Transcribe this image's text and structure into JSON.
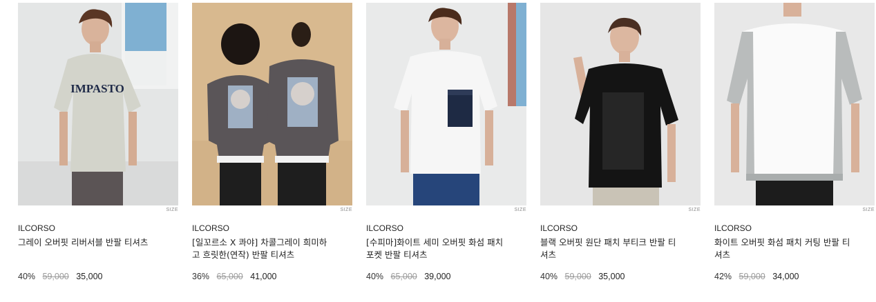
{
  "products": [
    {
      "image_alt": "gray oversized reversible t-shirt model",
      "size_tag": "SIZE",
      "brand": "ILCORSO",
      "name": "그레이 오버핏 리버서블 반팔 티셔츠",
      "discount": "40%",
      "original_price": "59,000",
      "sale_price": "35,000",
      "shirt_print": "IMPASTO",
      "colors": {
        "bg": "#e4e6e6",
        "shirt": "#d3d4cb",
        "pants": "#5b5455"
      }
    },
    {
      "image_alt": "two models back view charcoal gray t-shirts",
      "size_tag": "SIZE",
      "brand": "ILCORSO",
      "name": "[일꼬르소 X 콰야] 차콜그레이 희미하고 흐릿한(연작) 반팔 티셔츠",
      "discount": "36%",
      "original_price": "65,000",
      "sale_price": "41,000",
      "colors": {
        "bg": "#d8b98f",
        "shirt": "#5a5558",
        "pants": "#1e1e1e"
      }
    },
    {
      "image_alt": "white semi oversized pocket t-shirt model",
      "size_tag": "SIZE",
      "brand": "ILCORSO",
      "name": "[수피마]화이트 세미 오버핏 화섬 패치 포켓 반팔 티셔츠",
      "discount": "40%",
      "original_price": "65,000",
      "sale_price": "39,000",
      "colors": {
        "bg": "#e9eaea",
        "shirt": "#f6f6f6",
        "pants": "#26457a"
      }
    },
    {
      "image_alt": "black oversized boutique patch t-shirt model",
      "size_tag": "SIZE",
      "brand": "ILCORSO",
      "name": "블랙 오버핏 원단 패치 부티크 반팔 티셔츠",
      "discount": "40%",
      "original_price": "59,000",
      "sale_price": "35,000",
      "colors": {
        "bg": "#e6e6e6",
        "shirt": "#141414",
        "pants": "#c9c3b6"
      }
    },
    {
      "image_alt": "white oversized patch cutting t-shirt model",
      "size_tag": "SIZE",
      "brand": "ILCORSO",
      "name": "화이트 오버핏 화섬 패치 커팅 반팔 티셔츠",
      "discount": "42%",
      "original_price": "59,000",
      "sale_price": "34,000",
      "colors": {
        "bg": "#e8e8e8",
        "shirt": "#fafafa",
        "pants": "#1c1c1c"
      }
    }
  ]
}
